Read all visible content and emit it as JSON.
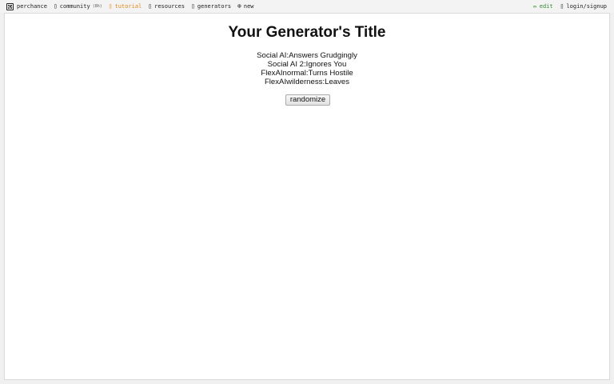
{
  "nav": {
    "left": [
      {
        "name": "perchance",
        "label": "perchance",
        "icon": "dice-icon"
      },
      {
        "name": "community",
        "label": "community",
        "badge": "(8h)",
        "icon": "chat-icon"
      },
      {
        "name": "tutorial",
        "label": "tutorial",
        "icon": "book-icon",
        "color": "#e08a1e"
      },
      {
        "name": "resources",
        "label": "resources",
        "icon": "folder-icon"
      },
      {
        "name": "generators",
        "label": "generators",
        "icon": "list-icon"
      },
      {
        "name": "new",
        "label": "new",
        "icon": "plus-circle-icon"
      }
    ],
    "right": [
      {
        "name": "edit",
        "label": "edit",
        "icon": "pencil-icon",
        "color": "#2f8a2f"
      },
      {
        "name": "login",
        "label": "login/signup",
        "icon": "user-icon"
      }
    ]
  },
  "generator": {
    "title": "Your Generator's Title",
    "output_lines": [
      "Social AI:Answers Grudgingly",
      "Social AI 2:Ignores You",
      "FlexAInormal:Turns Hostile",
      "FlexAIwilderness:Leaves"
    ],
    "randomize_label": "randomize"
  }
}
